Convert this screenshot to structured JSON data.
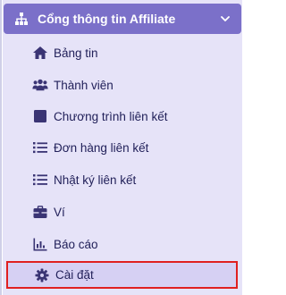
{
  "menu": {
    "header": {
      "title": "Cổng thông tin Affiliate",
      "icon": "sitemap-icon",
      "chevron": "chevron-down-icon"
    },
    "items": [
      {
        "label": "Bảng tin",
        "icon": "home-icon"
      },
      {
        "label": "Thành viên",
        "icon": "users-icon"
      },
      {
        "label": "Chương trình liên kết",
        "icon": "square-icon"
      },
      {
        "label": "Đơn hàng liên kết",
        "icon": "list-icon"
      },
      {
        "label": "Nhật ký liên kết",
        "icon": "list-icon"
      },
      {
        "label": "Ví",
        "icon": "briefcase-icon"
      },
      {
        "label": "Báo cáo",
        "icon": "chart-icon"
      },
      {
        "label": "Cài đặt",
        "icon": "gear-icon",
        "active": true
      }
    ]
  },
  "colors": {
    "header_bg": "#7b70c9",
    "panel_bg": "#e6e3f8",
    "text": "#22215a",
    "icon": "#3a3474",
    "highlight_border": "#e02020"
  }
}
